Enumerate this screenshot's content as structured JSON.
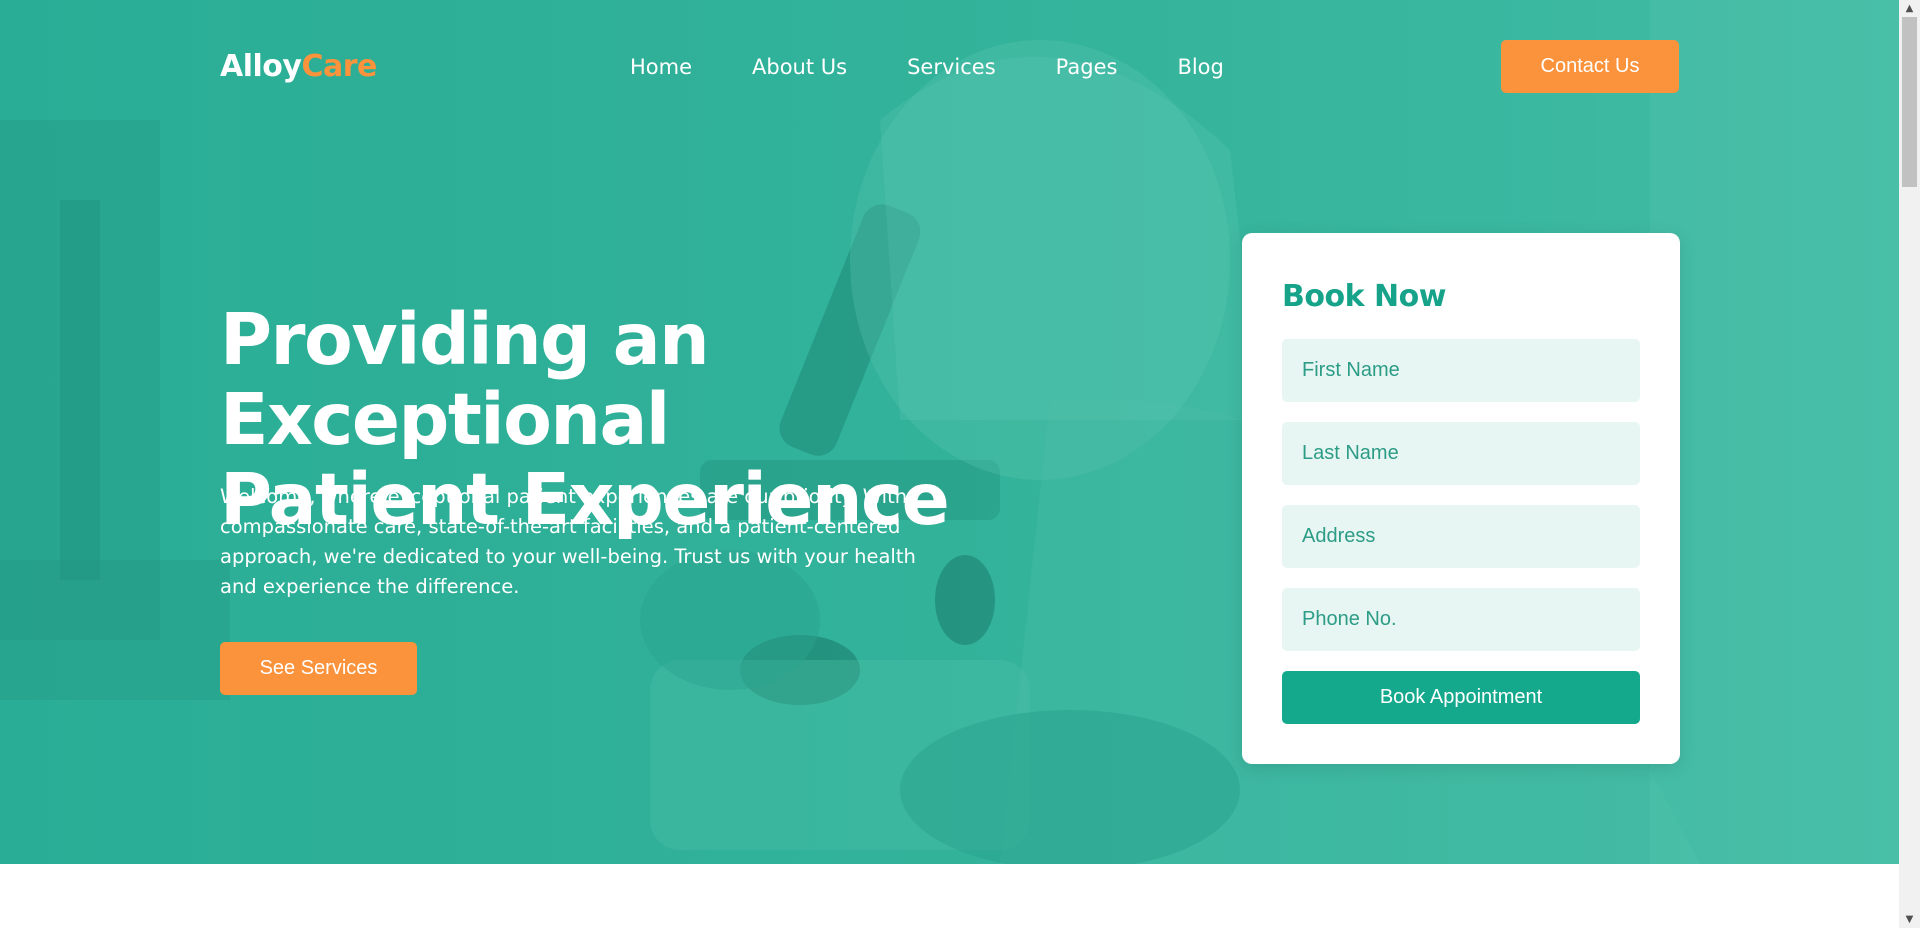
{
  "brand": {
    "name_part1": "Alloy",
    "name_part2": "Care"
  },
  "nav": {
    "items": [
      {
        "label": "Home"
      },
      {
        "label": "About Us"
      },
      {
        "label": "Services"
      },
      {
        "label": "Pages"
      },
      {
        "label": "Blog"
      }
    ],
    "contact_label": "Contact Us"
  },
  "hero": {
    "headline_line1": "Providing an Exceptional",
    "headline_line2": "Patient Experience",
    "lead": "Welcome, where exceptional patient experiences are our priority. With compassionate care, state-of-the-art facilities, and a patient-centered approach, we're dedicated to your well-being. Trust us with your health and experience the difference.",
    "cta_label": "See Services",
    "background_image": "lab-scientist-microscope-photo"
  },
  "booking": {
    "title": "Book Now",
    "first_name_placeholder": "First Name",
    "last_name_placeholder": "Last Name",
    "address_placeholder": "Address",
    "phone_placeholder": "Phone No.",
    "submit_label": "Book Appointment"
  },
  "colors": {
    "primary": "#14a98d",
    "accent": "#fb923c",
    "hero_overlay": "#33b39a",
    "field_bg": "#e7f6f3"
  },
  "scrollbar": {
    "up_icon": "triangle-up-icon",
    "down_icon": "triangle-down-icon"
  }
}
